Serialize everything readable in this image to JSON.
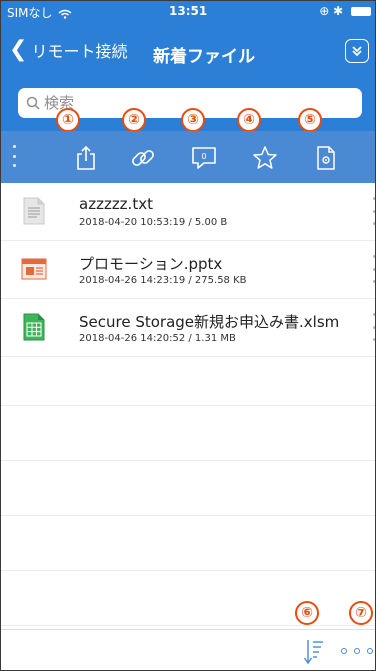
{
  "status_bar": {
    "carrier": "SIMなし",
    "time": "13:51"
  },
  "nav": {
    "back_label": "リモート接続",
    "title": "新着ファイル"
  },
  "search": {
    "placeholder": "検索"
  },
  "callouts": [
    "①",
    "②",
    "③",
    "④",
    "⑤",
    "⑥",
    "⑦"
  ],
  "toolbar": {
    "comment_count": "0"
  },
  "files": [
    {
      "name": "azzzzz.txt",
      "meta": "2018-04-20 10:53:19 / 5.00 B",
      "type": "txt",
      "icon": "text-file-icon"
    },
    {
      "name": "プロモーション.pptx",
      "meta": "2018-04-26 14:23:19 / 275.58 KB",
      "type": "pptx",
      "icon": "presentation-file-icon"
    },
    {
      "name": "Secure Storage新規お申込み書.xlsm",
      "meta": "2018-04-26 14:20:52 / 1.31 MB",
      "type": "xlsm",
      "icon": "spreadsheet-file-icon"
    }
  ],
  "colors": {
    "accent": "#2b7fd6",
    "toolbar": "#4a8ad4",
    "callout": "#e74c0d"
  }
}
